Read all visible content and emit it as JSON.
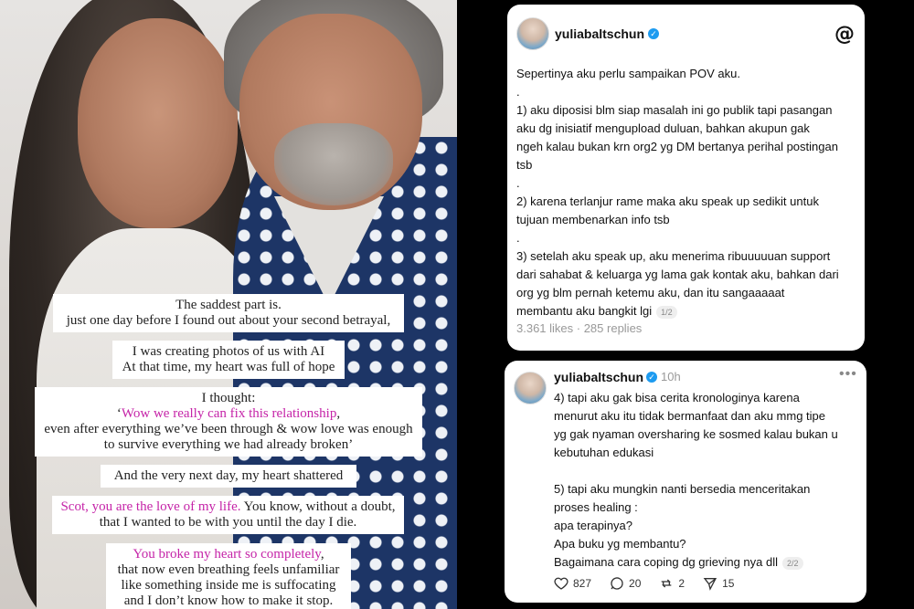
{
  "captions": [
    {
      "lines": [
        {
          "parts": [
            {
              "text": "The saddest part is.",
              "pink": false
            }
          ]
        },
        {
          "parts": [
            {
              "text": "just one day before I found out about your second betrayal,",
              "pink": false
            }
          ]
        }
      ]
    },
    {
      "lines": [
        {
          "parts": [
            {
              "text": "I was creating photos of us with AI",
              "pink": false
            }
          ]
        },
        {
          "parts": [
            {
              "text": "At that time, my heart was full of hope",
              "pink": false
            }
          ]
        }
      ]
    },
    {
      "lines": [
        {
          "parts": [
            {
              "text": "I thought:",
              "pink": false
            }
          ]
        },
        {
          "parts": [
            {
              "text": "‘",
              "pink": false
            },
            {
              "text": "Wow we really can fix this relationship",
              "pink": true
            },
            {
              "text": ",",
              "pink": false
            }
          ]
        },
        {
          "parts": [
            {
              "text": "even after everything we’ve been through & wow love was enough",
              "pink": false
            }
          ]
        },
        {
          "parts": [
            {
              "text": "to survive everything we had already broken’",
              "pink": false
            }
          ]
        }
      ]
    },
    {
      "lines": [
        {
          "parts": [
            {
              "text": "And the very next day, my heart shattered",
              "pink": false
            }
          ]
        }
      ]
    },
    {
      "lines": [
        {
          "parts": [
            {
              "text": "Scot, you are the love of my life.",
              "pink": true
            },
            {
              "text": " You know, without a doubt,",
              "pink": false
            }
          ]
        },
        {
          "parts": [
            {
              "text": "that I wanted to be with you until the day I die.",
              "pink": false
            }
          ]
        }
      ]
    },
    {
      "lines": [
        {
          "parts": [
            {
              "text": "You broke my heart so completely",
              "pink": true
            },
            {
              "text": ",",
              "pink": false
            }
          ]
        },
        {
          "parts": [
            {
              "text": "that now even breathing feels unfamiliar",
              "pink": false
            }
          ]
        },
        {
          "parts": [
            {
              "text": "like something inside me is suffocating",
              "pink": false
            }
          ]
        },
        {
          "parts": [
            {
              "text": "and I don’t know how to make it stop.",
              "pink": false
            }
          ]
        }
      ]
    }
  ],
  "post1": {
    "username": "yuliabaltschun",
    "verified_icon": "verified-badge-icon",
    "app_icon": "threads-logo-icon",
    "app_glyph": "@",
    "lines": [
      "Sepertinya aku perlu sampaikan POV aku.",
      ".",
      "1) aku diposisi blm siap masalah ini go publik tapi pasangan",
      "aku dg inisiatif mengupload duluan, bahkan akupun gak",
      "ngeh kalau bukan krn org2 yg DM bertanya perihal postingan",
      "tsb",
      ".",
      "2) karena terlanjur rame maka aku speak up sedikit untuk",
      "tujuan membenarkan info tsb",
      ".",
      "3) setelah aku speak up, aku menerima ribuuuuuan support",
      "dari sahabat & keluarga yg lama gak kontak aku, bahkan dari",
      "org yg blm pernah ketemu aku, dan itu sangaaaaat",
      "membantu aku bangkit lgi"
    ],
    "page_indicator": "1/2",
    "stats": "3.361 likes · 285 replies"
  },
  "post2": {
    "username": "yuliabaltschun",
    "timestamp": "10h",
    "more_icon": "more-dots-icon",
    "lines": [
      "4) tapi aku gak bisa cerita kronologinya karena",
      "menurut aku itu tidak bermanfaat dan aku mmg tipe",
      "yg gak nyaman oversharing ke sosmed kalau bukan u",
      "kebutuhan edukasi",
      "",
      "5) tapi aku mungkin nanti bersedia menceritakan",
      "proses healing :",
      "apa terapinya?",
      "Apa buku yg membantu?",
      "Bagaimana cara coping dg grieving nya dll"
    ],
    "page_indicator": "2/2",
    "actions": {
      "likes": "827",
      "replies": "20",
      "reposts": "2",
      "shares": "15"
    }
  }
}
